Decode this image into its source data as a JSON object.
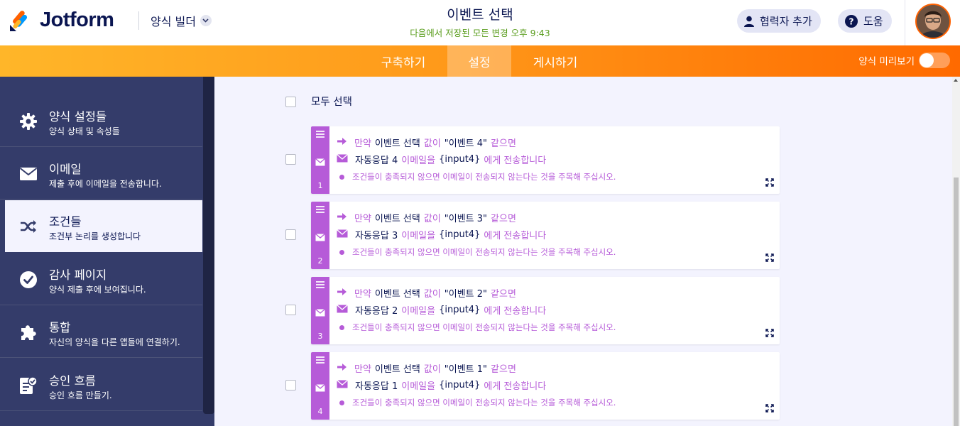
{
  "header": {
    "logo_text": "Jotform",
    "builder_menu": "양식 빌더",
    "form_title": "이벤트 선택",
    "save_status": "다음에서 저장된 모든 변경 오후 9:43",
    "add_collaborator": "협력자 추가",
    "help": "도움"
  },
  "nav": {
    "tabs": [
      "구축하기",
      "설정",
      "게시하기"
    ],
    "active_tab": "설정",
    "preview_label": "양식 미리보기"
  },
  "sidebar": {
    "items": [
      {
        "title": "양식 설정들",
        "desc": "양식 상태 및 속성들",
        "icon": "gear-icon"
      },
      {
        "title": "이메일",
        "desc": "제출 후에 이메일을 전송합니다.",
        "icon": "envelope-icon"
      },
      {
        "title": "조건들",
        "desc": "조건부 논리를 생성합니다",
        "icon": "shuffle-icon",
        "active": true
      },
      {
        "title": "감사 페이지",
        "desc": "양식 제출 후에 보여집니다.",
        "icon": "check-circle-icon"
      },
      {
        "title": "통합",
        "desc": "자신의 양식을 다른 앱들에 연결하기.",
        "icon": "puzzle-icon"
      },
      {
        "title": "승인 흐름",
        "desc": "승인 흐름 만들기.",
        "icon": "approval-icon"
      }
    ]
  },
  "main": {
    "select_all": "모두 선택",
    "conditions": [
      {
        "num": "1",
        "if": "만약",
        "field": "이벤트 선택",
        "value_kw": "값이",
        "value": "\"이벤트 4\"",
        "equals": "같으면",
        "email": "자동응답 4",
        "email_kw": "이메일을",
        "to": "{input4}",
        "send_kw": "에게 전송합니다",
        "note": "조건들이 충족되지 않으면 이메일이 전송되지 않는다는 것을 주목해 주십시오."
      },
      {
        "num": "2",
        "if": "만약",
        "field": "이벤트 선택",
        "value_kw": "값이",
        "value": "\"이벤트 3\"",
        "equals": "같으면",
        "email": "자동응답 3",
        "email_kw": "이메일을",
        "to": "{input4}",
        "send_kw": "에게 전송합니다",
        "note": "조건들이 충족되지 않으면 이메일이 전송되지 않는다는 것을 주목해 주십시오."
      },
      {
        "num": "3",
        "if": "만약",
        "field": "이벤트 선택",
        "value_kw": "값이",
        "value": "\"이벤트 2\"",
        "equals": "같으면",
        "email": "자동응답 2",
        "email_kw": "이메일을",
        "to": "{input4}",
        "send_kw": "에게 전송합니다",
        "note": "조건들이 충족되지 않으면 이메일이 전송되지 않는다는 것을 주목해 주십시오."
      },
      {
        "num": "4",
        "if": "만약",
        "field": "이벤트 선택",
        "value_kw": "값이",
        "value": "\"이벤트 1\"",
        "equals": "같으면",
        "email": "자동응답 1",
        "email_kw": "이메일을",
        "to": "{input4}",
        "send_kw": "에게 전송합니다",
        "note": "조건들이 충족되지 않으면 이메일이 전송되지 않는다는 것을 주목해 주십시오."
      }
    ]
  },
  "colors": {
    "brand_orange": "#ff6100",
    "condition_purple": "#b65bd8",
    "sidebar_bg": "#343c6a",
    "navy": "#0a1551",
    "saved_green": "#5a9d1d"
  }
}
